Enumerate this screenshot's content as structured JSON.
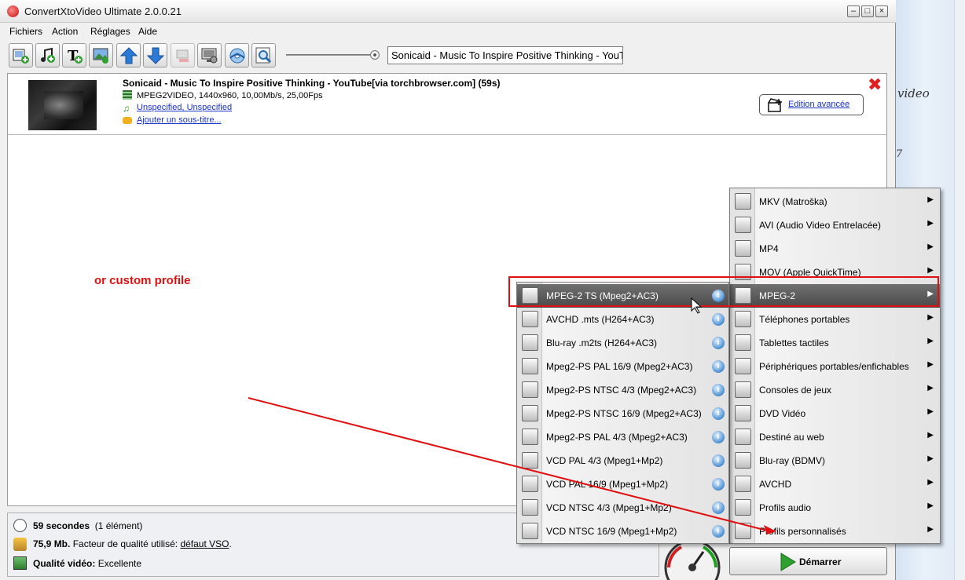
{
  "window": {
    "title": "ConvertXtoVideo Ultimate 2.0.0.21"
  },
  "menubar": {
    "items": [
      "Fichiers",
      "Action",
      "Réglages",
      "Aide"
    ]
  },
  "title_field": {
    "value": "Sonicaid - Music To Inspire Positive Thinking - YouT"
  },
  "file": {
    "title": "Sonicaid - Music To Inspire Positive Thinking - YouTube[via torchbrowser.com] (59s)",
    "video_info": "MPEG2VIDEO, 1440x960, 10,00Mb/s, 25,00Fps",
    "audio_link": "Unspecified, Unspecified",
    "subtitle_link": "Ajouter un sous-titre..."
  },
  "edit_button": {
    "label": "Edition avancée"
  },
  "annotation": {
    "text": "or custom profile"
  },
  "status": {
    "duration_bold": "59 secondes",
    "duration_rest": "(1 élément)",
    "size_bold": "75,9 Mb.",
    "size_rest": "Facteur de qualité utilisé:",
    "size_link": "défaut VSO",
    "size_end": ".",
    "quality_bold": "Qualité vidéo:",
    "quality_value": "Excellente"
  },
  "start_button": {
    "label": "Démarrer"
  },
  "main_menu": {
    "items": [
      "MKV (Matroška)",
      "AVI (Audio Video Entrelacée)",
      "MP4",
      "MOV (Apple QuickTime)",
      "MPEG-2",
      "Téléphones portables",
      "Tablettes tactiles",
      "Périphériques portables/enfichables",
      "Consoles de jeux",
      "DVD Vidéo",
      "Destiné au web",
      "Blu-ray (BDMV)",
      "AVCHD",
      "Profils audio",
      "Profils personnalisés"
    ],
    "highlighted_index": 4
  },
  "sub_menu": {
    "items": [
      "MPEG-2 TS (Mpeg2+AC3)",
      "AVCHD .mts (H264+AC3)",
      "Blu-ray .m2ts (H264+AC3)",
      "Mpeg2-PS PAL 16/9 (Mpeg2+AC3)",
      "Mpeg2-PS NTSC 4/3 (Mpeg2+AC3)",
      "Mpeg2-PS NTSC 16/9 (Mpeg2+AC3)",
      "Mpeg2-PS PAL 4/3 (Mpeg2+AC3)",
      "VCD PAL 4/3 (Mpeg1+Mp2)",
      "VCD PAL 16/9 (Mpeg1+Mp2)",
      "VCD NTSC 4/3 (Mpeg1+Mp2)",
      "VCD NTSC 16/9 (Mpeg1+Mp2)"
    ],
    "highlighted_index": 0,
    "info_glyph": "i"
  },
  "background_window": {
    "text_video": "video",
    "text_7": "7"
  },
  "colors": {
    "annotation_red": "#e01010",
    "link_blue": "#1a33c8",
    "highlight": "#5a5a5a"
  }
}
